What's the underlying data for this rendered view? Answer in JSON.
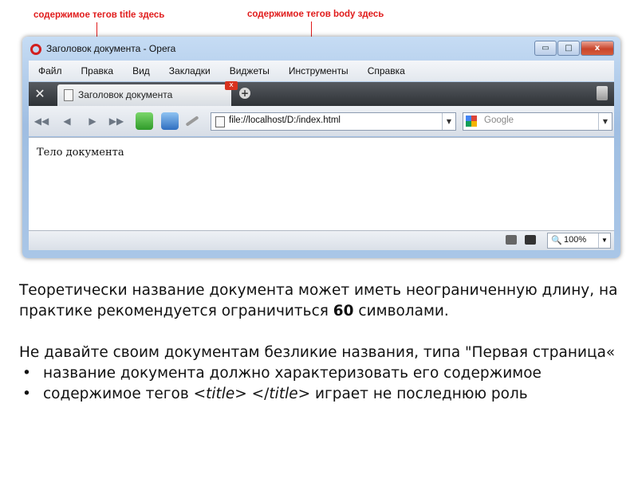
{
  "annotations": {
    "title_note": "содержимое тегов title здесь",
    "body_note": "содержимое тегов body здесь"
  },
  "browser": {
    "window_title": "Заголовок документа - Opera",
    "controls": {
      "minimize": "▭",
      "maximize": "□",
      "close": "x"
    },
    "menu": [
      "Файл",
      "Правка",
      "Вид",
      "Закладки",
      "Виджеты",
      "Инструменты",
      "Справка"
    ],
    "tab": {
      "label": "Заголовок документа",
      "close": "x",
      "new_tab": "+"
    },
    "nav": {
      "rewind": "◀◀",
      "back": "◀",
      "forward": "▶",
      "fast_forward": "▶▶"
    },
    "address": {
      "value": "file://localhost/D:/index.html",
      "dropdown": "▼"
    },
    "search": {
      "placeholder": "Google",
      "dropdown": "▼"
    },
    "page_body_text": "Тело документа",
    "status": {
      "zoom": "100%",
      "zoom_icon": "🔍",
      "dropdown": "▼"
    },
    "icons": {
      "tools": "wrench-icon",
      "reload": "reload-icon",
      "home": "home-icon",
      "wand": "wand-icon",
      "trash": "trash-icon",
      "document": "document-icon"
    }
  },
  "slide": {
    "para1_part1": "Теоретически название документа может иметь неограниченную длину, на практике рекомендуется ограничиться ",
    "para1_bold": "60",
    "para1_part2": " символами.",
    "para2": "Не давайте своим документам безликие названия, типа \"Первая страница«",
    "bullet1": "название документа должно характеризовать его содержимое",
    "bullet2_prefix": "содержимое тегов <",
    "bullet2_tag1": "title",
    "bullet2_mid": "> </",
    "bullet2_tag2": "title",
    "bullet2_suffix": "> играет не последнюю роль"
  },
  "colors": {
    "annotation": "#e01b1b",
    "accent": "#d21f1f"
  }
}
